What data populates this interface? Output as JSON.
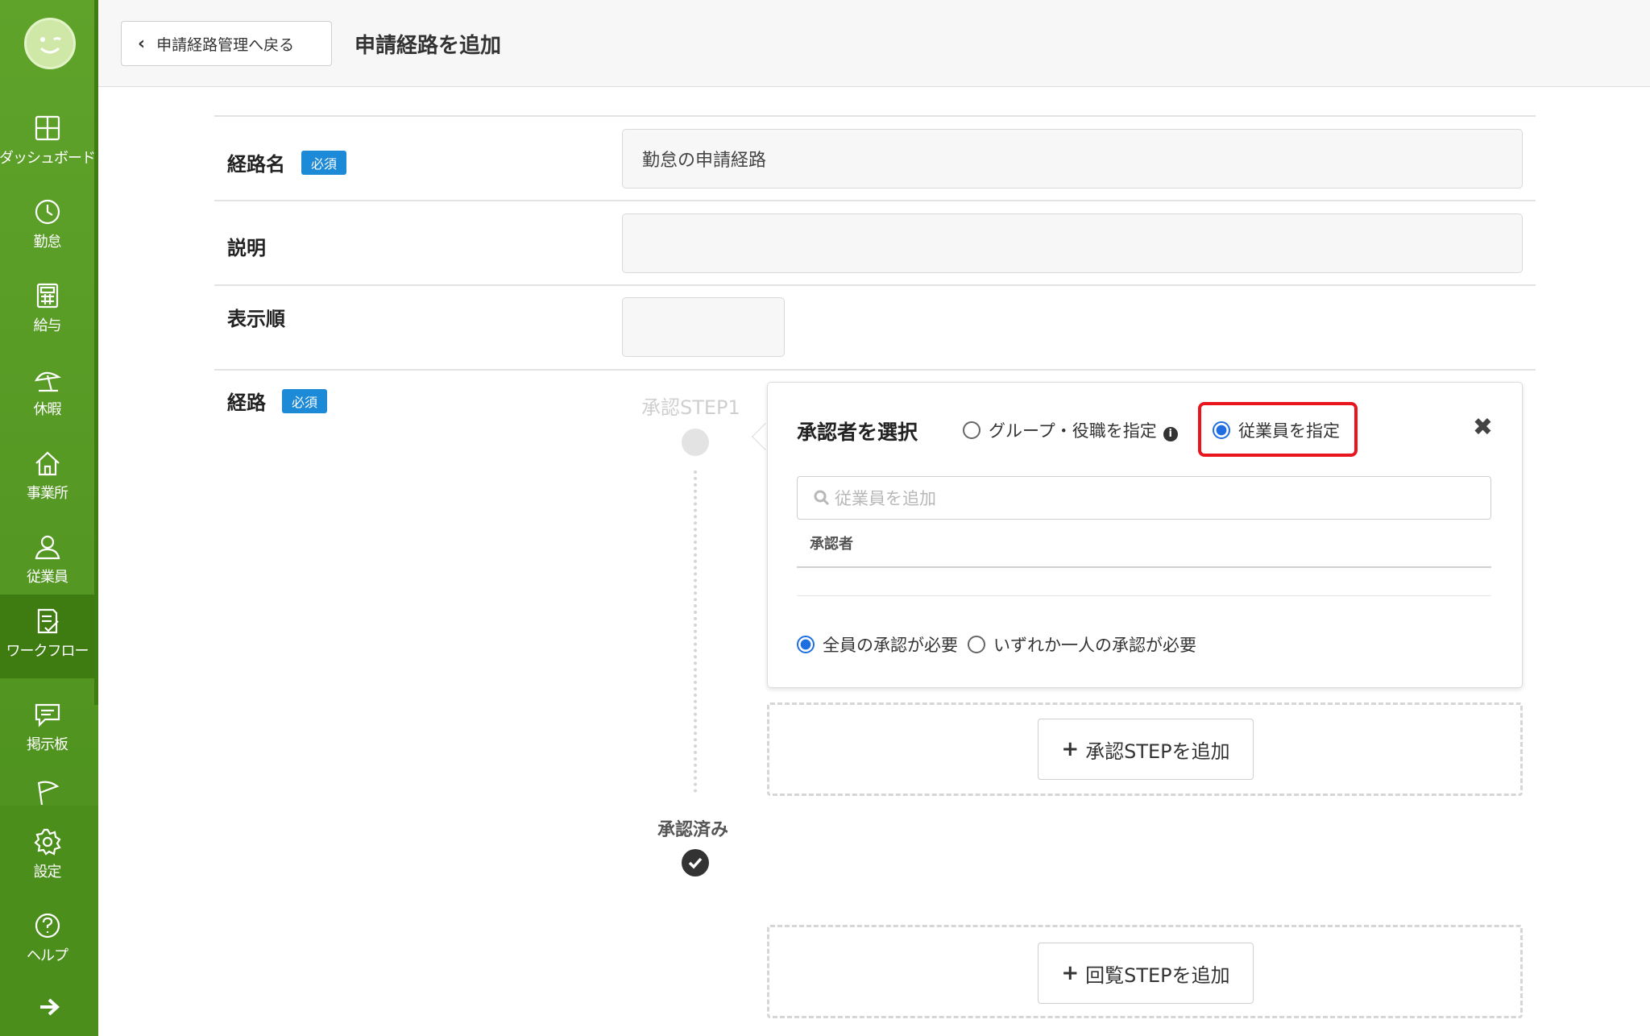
{
  "header": {
    "back_label": "申請経路管理へ戻る",
    "title": "申請経路を追加"
  },
  "sidebar": {
    "items": [
      {
        "label": "ダッシュボード",
        "icon": "dashboard-icon"
      },
      {
        "label": "勤怠",
        "icon": "clock-icon"
      },
      {
        "label": "給与",
        "icon": "calculator-icon"
      },
      {
        "label": "休暇",
        "icon": "umbrella-icon"
      },
      {
        "label": "事業所",
        "icon": "home-icon"
      },
      {
        "label": "従業員",
        "icon": "person-icon"
      },
      {
        "label": "ワークフロー",
        "icon": "workflow-icon",
        "active": true
      },
      {
        "label": "掲示板",
        "icon": "message-icon"
      },
      {
        "label": "設定",
        "icon": "gear-icon"
      },
      {
        "label": "ヘルプ",
        "icon": "help-icon"
      }
    ]
  },
  "form": {
    "route_name": {
      "label": "経路名",
      "required": "必須",
      "value": "勤怠の申請経路"
    },
    "description": {
      "label": "説明",
      "value": ""
    },
    "display_order": {
      "label": "表示順",
      "value": ""
    },
    "route": {
      "label": "経路",
      "required": "必須"
    }
  },
  "timeline": {
    "step_title": "承認STEP1",
    "approved_label": "承認済み"
  },
  "panel": {
    "title": "承認者を選択",
    "option_group": "グループ・役職を指定",
    "option_employee": "従業員を指定",
    "selected_option": "従業員を指定",
    "search_placeholder": "従業員を追加",
    "approver_header": "承認者",
    "option_all": "全員の承認が必要",
    "option_any": "いずれか一人の承認が必要",
    "selected_requirement": "全員の承認が必要"
  },
  "buttons": {
    "add_approval_step": "承認STEPを追加",
    "add_review_step": "回覧STEPを追加"
  },
  "colors": {
    "sidebar": "#5fa32b",
    "badge": "#1c8ad6",
    "highlight": "#e8141e",
    "radio_selected": "#1f6fe0"
  }
}
